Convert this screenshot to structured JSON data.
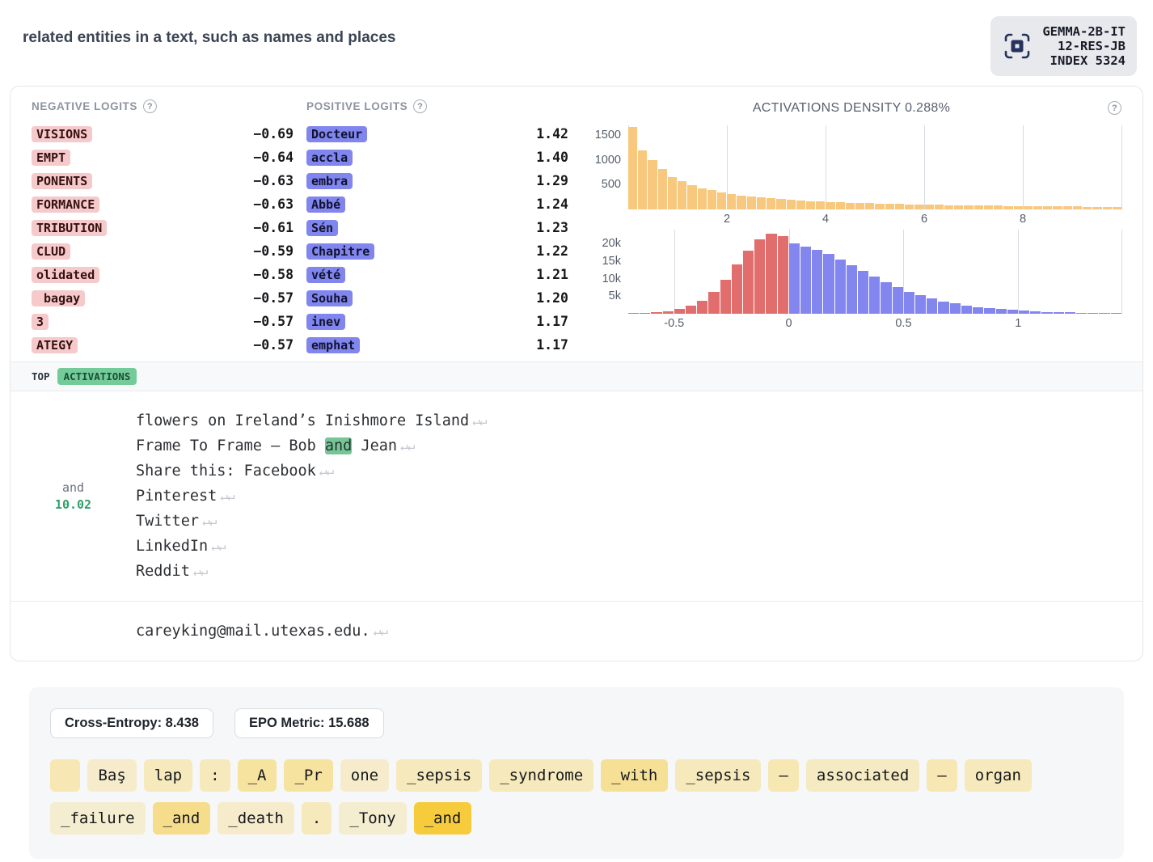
{
  "icons": {
    "help": "?"
  },
  "header": {
    "title": "related entities in a text, such as names and places",
    "model_badge": {
      "lines": [
        "GEMMA-2B-IT",
        "12-RES-JB",
        "INDEX 5324"
      ]
    }
  },
  "logits": {
    "negative_label": "NEGATIVE LOGITS",
    "positive_label": "POSITIVE LOGITS",
    "negative": [
      {
        "token": "VISIONS",
        "value": "−0.69"
      },
      {
        "token": "EMPT",
        "value": "−0.64"
      },
      {
        "token": "PONENTS",
        "value": "−0.63"
      },
      {
        "token": "FORMANCE",
        "value": "−0.63"
      },
      {
        "token": "TRIBUTION",
        "value": "−0.61"
      },
      {
        "token": "CLUD",
        "value": "−0.59"
      },
      {
        "token": "olidated",
        "value": "−0.58"
      },
      {
        "token": " bagay",
        "value": "−0.57"
      },
      {
        "token": "3",
        "value": "−0.57"
      },
      {
        "token": "ATEGY",
        "value": "−0.57"
      }
    ],
    "positive": [
      {
        "token": "Docteur",
        "value": "1.42"
      },
      {
        "token": "accla",
        "value": "1.40"
      },
      {
        "token": "embra",
        "value": "1.29"
      },
      {
        "token": "Abbé",
        "value": "1.24"
      },
      {
        "token": "Sén",
        "value": "1.23"
      },
      {
        "token": "Chapitre",
        "value": "1.22"
      },
      {
        "token": "vété",
        "value": "1.21"
      },
      {
        "token": "Souha",
        "value": "1.20"
      },
      {
        "token": "inev",
        "value": "1.17"
      },
      {
        "token": "emphat",
        "value": "1.17"
      }
    ]
  },
  "density_title": "ACTIVATIONS DENSITY 0.288%",
  "chart_data": [
    {
      "type": "bar",
      "title": "Activation density histogram (positive activations)",
      "x_range": [
        0,
        10
      ],
      "x_tick_values": [
        2,
        4,
        6,
        8
      ],
      "x_ticks": [
        "2",
        "4",
        "6",
        "8"
      ],
      "extra_grid_values": [
        0,
        10
      ],
      "y_tick_values": [
        1500,
        1000,
        500
      ],
      "y_ticks": [
        "1500",
        "1000",
        "500"
      ],
      "y_max": 1700,
      "bar_color": "#f7c87e",
      "values": [
        1660,
        1190,
        990,
        810,
        660,
        570,
        490,
        430,
        385,
        345,
        315,
        285,
        262,
        242,
        224,
        208,
        194,
        182,
        171,
        161,
        152,
        144,
        137,
        130,
        124,
        118,
        113,
        108,
        103,
        99,
        95,
        91,
        88,
        85,
        82,
        79,
        76,
        74,
        71,
        69,
        67,
        65,
        63,
        61,
        59,
        58,
        56,
        55,
        53,
        52
      ]
    },
    {
      "type": "bar",
      "title": "Logit-weight histogram (negative red, positive blue)",
      "x_range": [
        -0.7,
        1.45
      ],
      "x_tick_values": [
        -0.5,
        0,
        0.5,
        1
      ],
      "x_ticks": [
        "-0.5",
        "0",
        "0.5",
        "1"
      ],
      "extra_grid_values": [
        1.45
      ],
      "y_tick_values": [
        20000,
        15000,
        10000,
        5000
      ],
      "y_ticks": [
        "20k",
        "15k",
        "10k",
        "5k"
      ],
      "y_max": 24000,
      "bin_start": -0.7,
      "bin_width": 0.05,
      "neg_color": "#e26d6d",
      "pos_color": "#8286ee",
      "values": [
        200,
        320,
        500,
        800,
        1300,
        2200,
        3800,
        6200,
        9800,
        14000,
        18000,
        21200,
        22800,
        22200,
        20000,
        19200,
        18200,
        17000,
        15500,
        13800,
        12200,
        10600,
        9000,
        7600,
        6300,
        5200,
        4300,
        3500,
        2900,
        2400,
        1950,
        1600,
        1300,
        1050,
        850,
        700,
        560,
        450,
        360,
        290,
        230,
        190,
        150
      ]
    }
  ],
  "activations": {
    "tab_top": "TOP",
    "tab_badge": "ACTIVATIONS",
    "items": [
      {
        "token": "and",
        "value": "10.02",
        "lines": [
          [
            {
              "text": "flowers on Ireland’s Inishmore Island"
            },
            {
              "text": "↵↵",
              "type": "ret"
            }
          ],
          [
            {
              "text": "Frame To Frame — Bob "
            },
            {
              "text": "and",
              "type": "highlight"
            },
            {
              "text": " Jean"
            },
            {
              "text": "↵↵",
              "type": "ret"
            }
          ],
          [
            {
              "text": "Share this: Facebook"
            },
            {
              "text": "↵↵",
              "type": "ret"
            }
          ],
          [
            {
              "text": "Pinterest"
            },
            {
              "text": "↵↵",
              "type": "ret"
            }
          ],
          [
            {
              "text": "Twitter"
            },
            {
              "text": "↵↵",
              "type": "ret"
            }
          ],
          [
            {
              "text": "LinkedIn"
            },
            {
              "text": "↵↵",
              "type": "ret"
            }
          ],
          [
            {
              "text": "Reddit"
            },
            {
              "text": "↵↵",
              "type": "ret"
            }
          ]
        ]
      },
      {
        "token": "",
        "value": "",
        "lines": [
          [
            {
              "text": "careyking@mail.utexas.edu."
            },
            {
              "text": "↵↵",
              "type": "ret"
            }
          ]
        ]
      }
    ]
  },
  "test_panel": {
    "metrics": [
      "Cross-Entropy: 8.438",
      "EPO Metric: 15.688"
    ],
    "tokens": [
      {
        "text": " ",
        "intensity": 0.35
      },
      {
        "text": "Baş",
        "intensity": 0.22
      },
      {
        "text": "lap",
        "intensity": 0.3
      },
      {
        "text": ":",
        "intensity": 0.3
      },
      {
        "text": "_A",
        "intensity": 0.45
      },
      {
        "text": "_Pr",
        "intensity": 0.45
      },
      {
        "text": "one",
        "intensity": 0.22
      },
      {
        "text": "_sepsis",
        "intensity": 0.3
      },
      {
        "text": "_syndrome",
        "intensity": 0.3
      },
      {
        "text": "_with",
        "intensity": 0.5
      },
      {
        "text": "_sepsis",
        "intensity": 0.3
      },
      {
        "text": "–",
        "intensity": 0.35
      },
      {
        "text": "associated",
        "intensity": 0.28
      },
      {
        "text": "–",
        "intensity": 0.35
      },
      {
        "text": "organ",
        "intensity": 0.3
      },
      {
        "text": "_failure",
        "intensity": 0.2
      },
      {
        "text": "_and",
        "intensity": 0.55
      },
      {
        "text": "_death",
        "intensity": 0.22
      },
      {
        "text": ".",
        "intensity": 0.3
      },
      {
        "text": "_Tony",
        "intensity": 0.2
      },
      {
        "text": "_and",
        "intensity": 0.95
      }
    ]
  }
}
